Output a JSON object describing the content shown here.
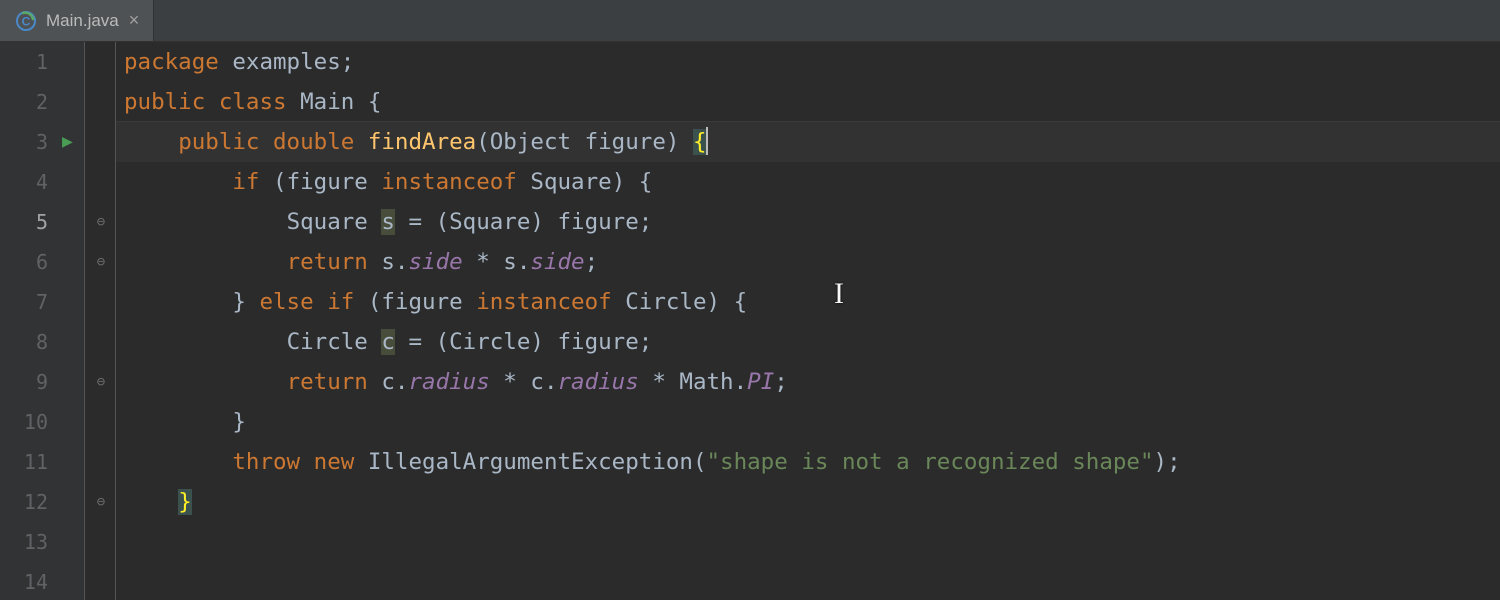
{
  "tab": {
    "filename": "Main.java",
    "icon": "java-class-icon",
    "close_glyph": "×"
  },
  "gutter": {
    "lines": [
      "1",
      "2",
      "3",
      "4",
      "5",
      "6",
      "7",
      "8",
      "9",
      "10",
      "11",
      "12",
      "13",
      "14"
    ],
    "current_line": 5,
    "run_marker_line": 3,
    "run_marker_glyph": "▶"
  },
  "fold": {
    "marks": [
      {
        "line": 5,
        "glyph": "⊖"
      },
      {
        "line": 6,
        "glyph": "⊖"
      },
      {
        "line": 9,
        "glyph": "⊖"
      },
      {
        "line": 12,
        "glyph": "⊖"
      }
    ]
  },
  "code": {
    "l1": {
      "kw_package": "package",
      "pkg": " examples",
      "semi": ";"
    },
    "l2": {
      "text": ""
    },
    "l3": {
      "kw_public": "public",
      "kw_class": "class",
      "cls": "Main",
      "brace_open": "{"
    },
    "l4": {
      "text": ""
    },
    "l5": {
      "kw_public": "public",
      "kw_double": "double",
      "method": "findArea",
      "paren_open": "(",
      "param_type": "Object",
      "param_name": "figure",
      "paren_close": ")",
      "brace_open": "{"
    },
    "l6": {
      "kw_if": "if",
      "po": "(",
      "var": "figure",
      "kw_instanceof": "instanceof",
      "type": "Square",
      "pc": ")",
      "brace_open": "{"
    },
    "l7": {
      "type": "Square",
      "var": "s",
      "eq": " = (",
      "cast": "Square",
      "rest": ") figure;"
    },
    "l8": {
      "kw_return": "return",
      "expr1": " s.",
      "field1": "side",
      "star": " * s.",
      "field2": "side",
      "semi": ";"
    },
    "l9": {
      "close": "}",
      "kw_else": "else",
      "kw_if": "if",
      "po": "(",
      "var": "figure",
      "kw_instanceof": "instanceof",
      "type": "Circle",
      "pc": ")",
      "brace_open": "{"
    },
    "l10": {
      "type": "Circle",
      "var": "c",
      "eq": " = (",
      "cast": "Circle",
      "rest": ") figure;"
    },
    "l11": {
      "kw_return": "return",
      "pre": " c.",
      "f1": "radius",
      "mid1": " * c.",
      "f2": "radius",
      "mid2": " * Math.",
      "f3": "PI",
      "semi": ";"
    },
    "l12": {
      "close": "}"
    },
    "l13": {
      "kw_throw": "throw",
      "kw_new": "new",
      "ex": "IllegalArgumentException",
      "po": "(",
      "str": "\"shape is not a recognized shape\"",
      "pc_semi": ");"
    },
    "l14": {
      "close": "}"
    }
  }
}
